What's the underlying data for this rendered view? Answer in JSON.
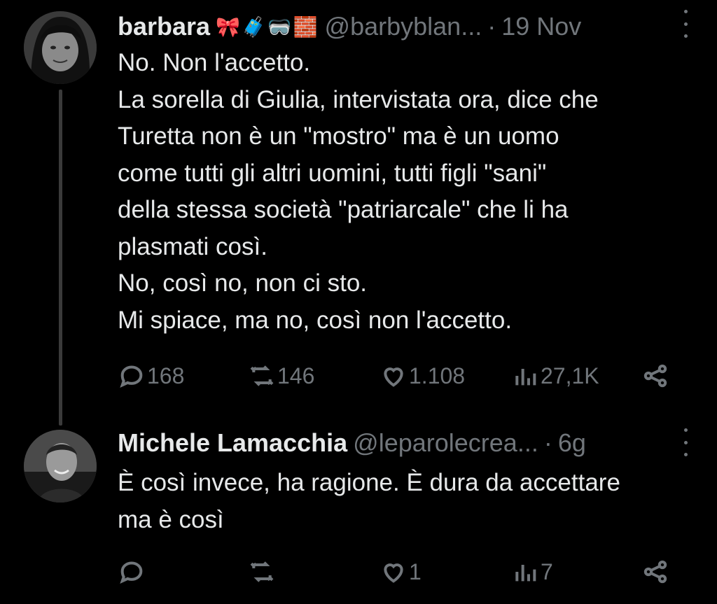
{
  "tweets": [
    {
      "author_name": "barbara",
      "author_emojis": "🎀🧳🥽🧱",
      "handle": "@barbyblan...",
      "separator": "·",
      "time": "19 Nov",
      "lines": [
        "No. Non l'accetto.",
        "La sorella di Giulia, intervistata ora, dice che",
        "Turetta non è un \"mostro\" ma è un uomo",
        "come tutti gli altri uomini, tutti figli \"sani\"",
        "della stessa società \"patriarcale\" che li ha",
        "plasmati così.",
        "No, così no, non ci sto.",
        "Mi spiace, ma no, così non l'accetto."
      ],
      "replies": "168",
      "retweets": "146",
      "likes": "1.108",
      "views": "27,1K"
    },
    {
      "author_name": "Michele Lamacchia",
      "handle": "@leparolecrea...",
      "separator": "·",
      "time": "6g",
      "lines": [
        "È così invece, ha ragione.  È dura da accettare",
        "ma è così"
      ],
      "replies": "",
      "retweets": "",
      "likes": "1",
      "views": "7"
    }
  ],
  "colors": {
    "background": "#000000",
    "text": "#e7e9ea",
    "muted": "#71767b"
  }
}
